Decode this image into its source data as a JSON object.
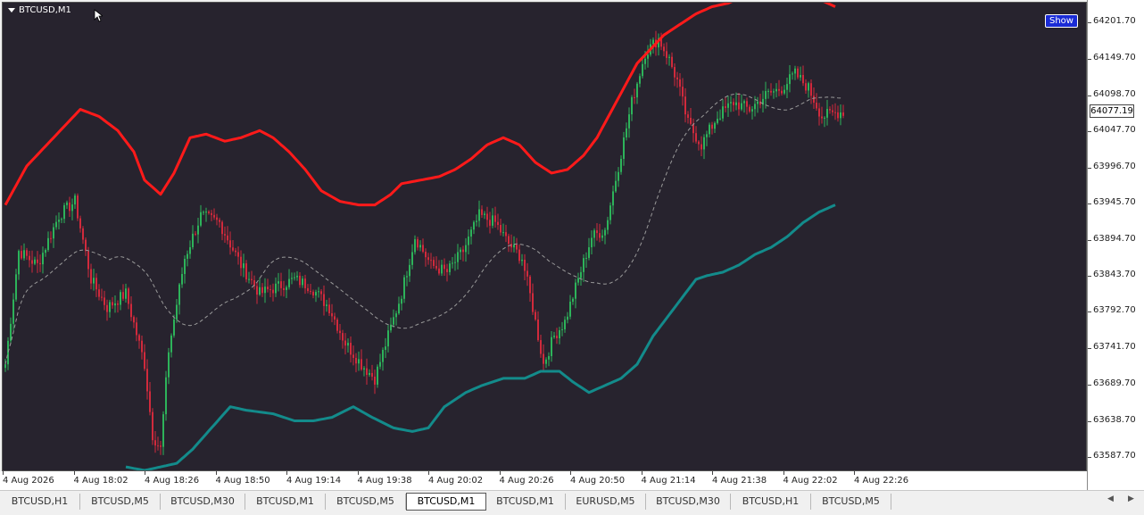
{
  "window": {
    "title": "BTCUSD,M1",
    "show_button": "Show"
  },
  "chart_data": {
    "type": "candlestick",
    "symbol": "BTCUSD",
    "timeframe": "M1",
    "price_ticks": [
      "64201.70",
      "64149.70",
      "64098.70",
      "64047.70",
      "63996.70",
      "63945.70",
      "63894.70",
      "63843.70",
      "63792.70",
      "63741.70",
      "63689.70",
      "63638.70",
      "63587.70"
    ],
    "current_price": "64077.19",
    "time_ticks": [
      "4 Aug 2026",
      "4 Aug 18:02",
      "4 Aug 18:26",
      "4 Aug 18:50",
      "4 Aug 19:14",
      "4 Aug 19:38",
      "4 Aug 20:02",
      "4 Aug 20:26",
      "4 Aug 20:50",
      "4 Aug 21:14",
      "4 Aug 21:38",
      "4 Aug 22:02",
      "4 Aug 22:26"
    ],
    "ylim": [
      63570,
      64225
    ],
    "grid": false,
    "colors": {
      "background": "#27232e",
      "bull": "#2db35a",
      "bear": "#d12a3c",
      "upper_band": "#ff1a1a",
      "lower_band": "#138b8b",
      "middle_band": "#9a9a9a"
    },
    "close_anchors": [
      [
        0,
        63720
      ],
      [
        5,
        63880
      ],
      [
        12,
        63860
      ],
      [
        20,
        63930
      ],
      [
        26,
        63950
      ],
      [
        32,
        63840
      ],
      [
        38,
        63800
      ],
      [
        45,
        63820
      ],
      [
        52,
        63720
      ],
      [
        55,
        63620
      ],
      [
        58,
        63600
      ],
      [
        61,
        63740
      ],
      [
        67,
        63870
      ],
      [
        73,
        63930
      ],
      [
        80,
        63920
      ],
      [
        88,
        63860
      ],
      [
        95,
        63820
      ],
      [
        102,
        63830
      ],
      [
        108,
        63840
      ],
      [
        114,
        63830
      ],
      [
        121,
        63800
      ],
      [
        127,
        63750
      ],
      [
        133,
        63720
      ],
      [
        138,
        63700
      ],
      [
        143,
        63760
      ],
      [
        148,
        63820
      ],
      [
        153,
        63900
      ],
      [
        159,
        63860
      ],
      [
        165,
        63850
      ],
      [
        171,
        63880
      ],
      [
        177,
        63930
      ],
      [
        183,
        63920
      ],
      [
        188,
        63890
      ],
      [
        193,
        63870
      ],
      [
        197,
        63800
      ],
      [
        201,
        63720
      ],
      [
        205,
        63760
      ],
      [
        209,
        63780
      ],
      [
        214,
        63840
      ],
      [
        219,
        63900
      ],
      [
        224,
        63910
      ],
      [
        229,
        64000
      ],
      [
        234,
        64090
      ],
      [
        239,
        64160
      ],
      [
        244,
        64180
      ],
      [
        248,
        64150
      ],
      [
        251,
        64120
      ],
      [
        255,
        64060
      ],
      [
        260,
        64030
      ],
      [
        266,
        64070
      ],
      [
        272,
        64090
      ],
      [
        278,
        64080
      ],
      [
        284,
        64100
      ],
      [
        290,
        64110
      ],
      [
        295,
        64130
      ],
      [
        300,
        64110
      ],
      [
        305,
        64070
      ],
      [
        310,
        64075
      ],
      [
        313,
        64077
      ]
    ],
    "upper_anchors": [
      [
        0,
        63945
      ],
      [
        8,
        64000
      ],
      [
        18,
        64040
      ],
      [
        28,
        64080
      ],
      [
        35,
        64070
      ],
      [
        42,
        64050
      ],
      [
        48,
        64020
      ],
      [
        52,
        63980
      ],
      [
        58,
        63960
      ],
      [
        63,
        63990
      ],
      [
        69,
        64040
      ],
      [
        75,
        64045
      ],
      [
        82,
        64035
      ],
      [
        88,
        64040
      ],
      [
        95,
        64050
      ],
      [
        100,
        64040
      ],
      [
        106,
        64020
      ],
      [
        112,
        63995
      ],
      [
        118,
        63965
      ],
      [
        125,
        63950
      ],
      [
        132,
        63945
      ],
      [
        138,
        63945
      ],
      [
        144,
        63960
      ],
      [
        148,
        63975
      ],
      [
        155,
        63980
      ],
      [
        162,
        63985
      ],
      [
        168,
        63995
      ],
      [
        174,
        64010
      ],
      [
        180,
        64030
      ],
      [
        186,
        64040
      ],
      [
        192,
        64030
      ],
      [
        198,
        64005
      ],
      [
        204,
        63990
      ],
      [
        210,
        63995
      ],
      [
        216,
        64015
      ],
      [
        221,
        64040
      ],
      [
        226,
        64075
      ],
      [
        231,
        64110
      ],
      [
        236,
        64145
      ],
      [
        241,
        64165
      ],
      [
        246,
        64185
      ],
      [
        252,
        64200
      ],
      [
        258,
        64215
      ],
      [
        264,
        64225
      ],
      [
        270,
        64230
      ],
      [
        276,
        64240
      ],
      [
        282,
        64245
      ],
      [
        288,
        64240
      ],
      [
        294,
        64245
      ],
      [
        300,
        64240
      ],
      [
        306,
        64232
      ],
      [
        310,
        64225
      ]
    ],
    "lower_anchors": [
      [
        45,
        63575
      ],
      [
        52,
        63570
      ],
      [
        58,
        63575
      ],
      [
        64,
        63580
      ],
      [
        70,
        63600
      ],
      [
        77,
        63630
      ],
      [
        84,
        63660
      ],
      [
        90,
        63655
      ],
      [
        100,
        63650
      ],
      [
        108,
        63640
      ],
      [
        115,
        63640
      ],
      [
        122,
        63645
      ],
      [
        130,
        63660
      ],
      [
        137,
        63645
      ],
      [
        145,
        63630
      ],
      [
        152,
        63625
      ],
      [
        158,
        63630
      ],
      [
        164,
        63660
      ],
      [
        172,
        63680
      ],
      [
        178,
        63690
      ],
      [
        186,
        63700
      ],
      [
        194,
        63700
      ],
      [
        200,
        63710
      ],
      [
        207,
        63710
      ],
      [
        212,
        63695
      ],
      [
        218,
        63680
      ],
      [
        224,
        63690
      ],
      [
        230,
        63700
      ],
      [
        236,
        63720
      ],
      [
        242,
        63760
      ],
      [
        248,
        63790
      ],
      [
        254,
        63820
      ],
      [
        258,
        63840
      ],
      [
        262,
        63845
      ],
      [
        268,
        63850
      ],
      [
        274,
        63860
      ],
      [
        280,
        63875
      ],
      [
        286,
        63885
      ],
      [
        292,
        63900
      ],
      [
        298,
        63920
      ],
      [
        304,
        63935
      ],
      [
        310,
        63945
      ]
    ]
  },
  "tabs": [
    {
      "label": "BTCUSD,H1",
      "active": false
    },
    {
      "label": "BTCUSD,M5",
      "active": false
    },
    {
      "label": "BTCUSD,M30",
      "active": false
    },
    {
      "label": "BTCUSD,M1",
      "active": false
    },
    {
      "label": "BTCUSD,M5",
      "active": false
    },
    {
      "label": "BTCUSD,M1",
      "active": true
    },
    {
      "label": "BTCUSD,M1",
      "active": false
    },
    {
      "label": "EURUSD,M5",
      "active": false
    },
    {
      "label": "BTCUSD,M30",
      "active": false
    },
    {
      "label": "BTCUSD,H1",
      "active": false
    },
    {
      "label": "BTCUSD,M5",
      "active": false
    }
  ],
  "icons": {
    "collapse": "triangle-down-icon",
    "cursor": "mouse-pointer-icon",
    "scroll_left": "chevron-left-icon",
    "scroll_right": "chevron-right-icon"
  }
}
